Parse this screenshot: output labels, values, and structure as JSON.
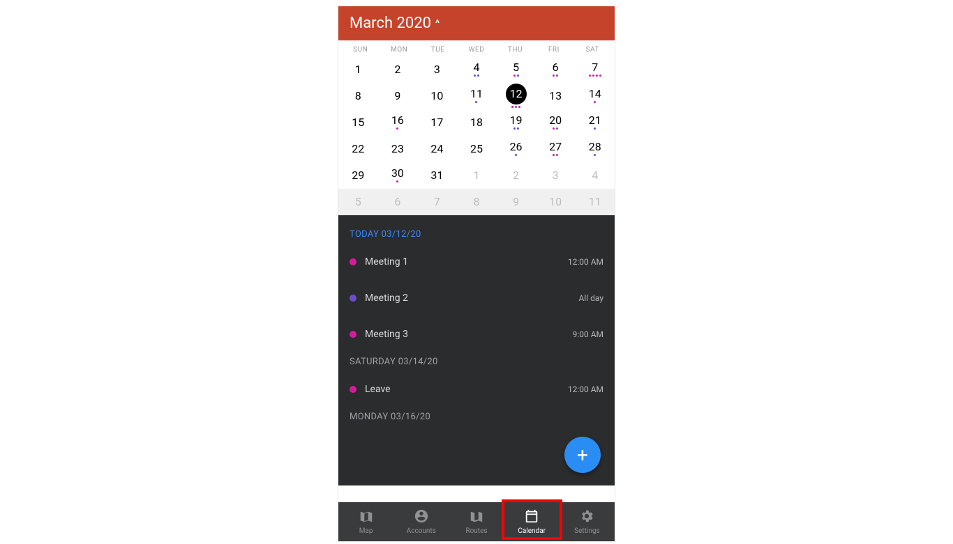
{
  "header": {
    "title": "March 2020"
  },
  "dow": [
    "SUN",
    "MON",
    "TUE",
    "WED",
    "THU",
    "FRI",
    "SAT"
  ],
  "days": [
    {
      "n": "1"
    },
    {
      "n": "2"
    },
    {
      "n": "3"
    },
    {
      "n": "4",
      "dots": [
        "purple",
        "purple"
      ]
    },
    {
      "n": "5",
      "dots": [
        "pink",
        "purple"
      ]
    },
    {
      "n": "6",
      "dots": [
        "pink",
        "purple"
      ]
    },
    {
      "n": "7",
      "dots": [
        "pink",
        "pink",
        "pink",
        "pink"
      ]
    },
    {
      "n": "8"
    },
    {
      "n": "9"
    },
    {
      "n": "10"
    },
    {
      "n": "11",
      "dots": [
        "purple"
      ]
    },
    {
      "n": "12",
      "selected": true,
      "dots": [
        "pink",
        "purple",
        "pink"
      ]
    },
    {
      "n": "13"
    },
    {
      "n": "14",
      "dots": [
        "pink"
      ]
    },
    {
      "n": "15"
    },
    {
      "n": "16",
      "dots": [
        "pink"
      ]
    },
    {
      "n": "17"
    },
    {
      "n": "18"
    },
    {
      "n": "19",
      "dots": [
        "purple",
        "purple"
      ]
    },
    {
      "n": "20",
      "dots": [
        "pink",
        "purple"
      ]
    },
    {
      "n": "21",
      "dots": [
        "purple"
      ]
    },
    {
      "n": "22"
    },
    {
      "n": "23"
    },
    {
      "n": "24"
    },
    {
      "n": "25"
    },
    {
      "n": "26",
      "dots": [
        "purple"
      ]
    },
    {
      "n": "27",
      "dots": [
        "pink",
        "purple"
      ]
    },
    {
      "n": "28",
      "dots": [
        "purple"
      ]
    },
    {
      "n": "29"
    },
    {
      "n": "30",
      "dots": [
        "pink"
      ]
    },
    {
      "n": "31"
    },
    {
      "n": "1",
      "dim": true
    },
    {
      "n": "2",
      "dim": true
    },
    {
      "n": "3",
      "dim": true
    },
    {
      "n": "4",
      "dim": true
    },
    {
      "n": "5",
      "dim": true,
      "bg": true
    },
    {
      "n": "6",
      "dim": true,
      "bg": true
    },
    {
      "n": "7",
      "dim": true,
      "bg": true
    },
    {
      "n": "8",
      "dim": true,
      "bg": true
    },
    {
      "n": "9",
      "dim": true,
      "bg": true
    },
    {
      "n": "10",
      "dim": true,
      "bg": true
    },
    {
      "n": "11",
      "dim": true,
      "bg": true
    }
  ],
  "agenda": [
    {
      "header": "TODAY 03/12/20",
      "today": true,
      "events": [
        {
          "color": "pink",
          "title": "Meeting 1",
          "time": "12:00 AM"
        },
        {
          "color": "purple",
          "title": "Meeting 2",
          "time": "All day"
        },
        {
          "color": "pink",
          "title": "Meeting 3",
          "time": "9:00 AM"
        }
      ]
    },
    {
      "header": "SATURDAY 03/14/20",
      "events": [
        {
          "color": "pink",
          "title": "Leave",
          "time": "12:00 AM"
        }
      ]
    },
    {
      "header": "MONDAY 03/16/20",
      "events": []
    }
  ],
  "tabs": [
    {
      "label": "Map"
    },
    {
      "label": "Accounts"
    },
    {
      "label": "Routes"
    },
    {
      "label": "Calendar",
      "active": true
    },
    {
      "label": "Settings"
    }
  ]
}
